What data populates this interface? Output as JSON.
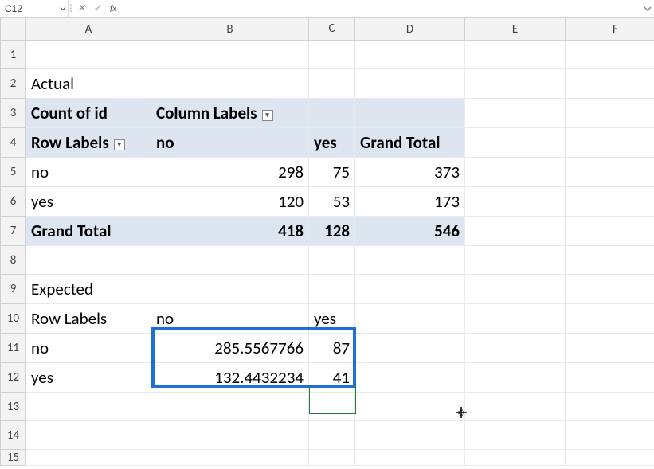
{
  "formula_bar": {
    "name_box": "C12",
    "cancel_label": "✕",
    "enter_label": "✓",
    "fx_label": "fx",
    "input_value": ""
  },
  "columns": [
    "A",
    "B",
    "C",
    "D",
    "E",
    "F"
  ],
  "rows": [
    "1",
    "2",
    "3",
    "4",
    "5",
    "6",
    "7",
    "8",
    "9",
    "10",
    "11",
    "12",
    "13",
    "14",
    "15"
  ],
  "cells": {
    "A2": "Actual",
    "A3": "Count of id",
    "B3": "Column Labels",
    "A4": "Row Labels",
    "B4": "no",
    "C4": "yes",
    "D4": "Grand Total",
    "A5": "no",
    "B5": "298",
    "C5": "75",
    "D5": "373",
    "A6": "yes",
    "B6": "120",
    "C6": "53",
    "D6": "173",
    "A7": "Grand Total",
    "B7": "418",
    "C7": "128",
    "D7": "546",
    "A9": "Expected",
    "A10": "Row Labels",
    "B10": "no",
    "C10": "yes",
    "A11": "no",
    "B11": "285.5567766",
    "C11": "87",
    "A12": "yes",
    "B12": "132.4432234",
    "C12": "41"
  },
  "filter_icon": "▾"
}
